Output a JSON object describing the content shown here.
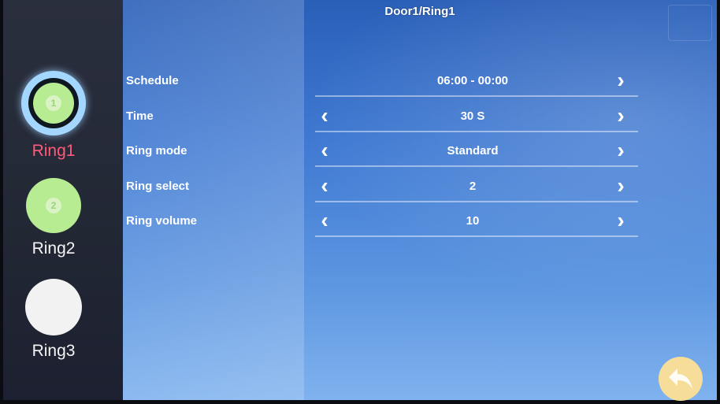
{
  "header": {
    "title": "Door1/Ring1"
  },
  "rings": [
    {
      "label": "Ring1",
      "active": true,
      "badge": "1"
    },
    {
      "label": "Ring2",
      "active": false,
      "badge": "2"
    },
    {
      "label": "Ring3",
      "active": false
    }
  ],
  "settings": [
    {
      "label": "Schedule",
      "value": "06:00 - 00:00"
    },
    {
      "label": "Time",
      "value": "30 S"
    },
    {
      "label": "Ring mode",
      "value": "Standard"
    },
    {
      "label": "Ring select",
      "value": "2"
    },
    {
      "label": "Ring volume",
      "value": "10"
    }
  ],
  "colors": {
    "active_ring_label": "#ff5a78",
    "ring_green": "#b7ec93",
    "back_button": "#f6dd9a"
  },
  "icons": {
    "back": "back-arrow-icon",
    "left": "chevron-left-icon",
    "right": "chevron-right-icon",
    "bell": "bell-icon"
  }
}
